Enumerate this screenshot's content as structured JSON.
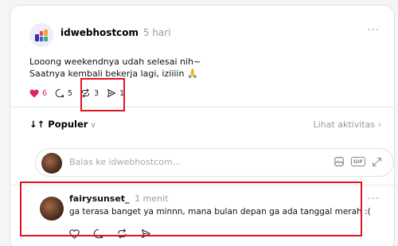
{
  "post": {
    "author": "idwebhostcom",
    "time": "5 hari",
    "line1": "Looong weekendnya udah selesai nih~",
    "line2": "Saatnya kembali bekerja lagi, iziiiin 🙏",
    "likes": "6",
    "replies": "5",
    "reposts": "3",
    "shares": "1",
    "more": "···"
  },
  "sort": {
    "label": "↓↑ Populer",
    "chevron": "∨"
  },
  "activity": {
    "label": "Lihat aktivitas",
    "chevron": "›"
  },
  "reply": {
    "placeholder": "Balas ke idwebhostcom...",
    "gif": "GIF"
  },
  "comment": {
    "author": "fairysunset_",
    "time": "1 menit",
    "text": "ga terasa banget ya minnn, mana bulan depan ga ada tanggal merah :(",
    "more": "···"
  },
  "icons": {
    "post_avatar": "brand-logo-icon",
    "like": "heart-icon",
    "reply": "comment-bubble-icon",
    "repost": "repost-icon",
    "share": "send-icon",
    "image": "image-icon",
    "gif": "gif-icon",
    "expand": "expand-icon"
  },
  "colors": {
    "like": "#e0245e",
    "highlight": "#e0141e",
    "muted": "#9a9a9a"
  }
}
